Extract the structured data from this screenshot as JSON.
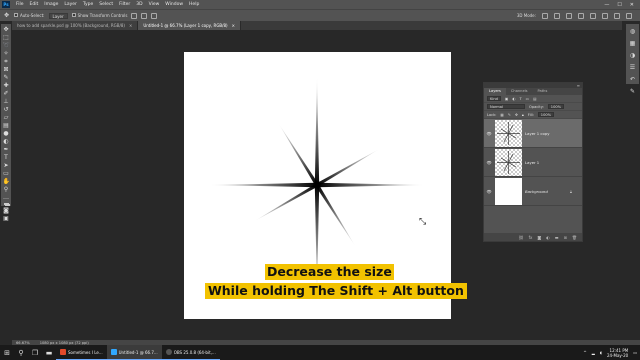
{
  "menubar": {
    "logo": "Ps",
    "items": [
      "File",
      "Edit",
      "Image",
      "Layer",
      "Type",
      "Select",
      "Filter",
      "3D",
      "View",
      "Window",
      "Help"
    ],
    "window_controls": [
      "—",
      "☐",
      "✕"
    ]
  },
  "options": {
    "auto_select_label": "Auto-Select:",
    "auto_select_value": "Layer",
    "transform_controls_label": "Show Transform Controls",
    "mode_label": "3D Mode:"
  },
  "tabs": [
    {
      "label": "how to add sparkle.psd @ 100% (Background, RGB/8)",
      "active": false
    },
    {
      "label": "Untitled-1 @ 66.7% (Layer 1 copy, RGB/8)",
      "active": true
    }
  ],
  "canvas": {
    "caption_1": "Decrease the size",
    "caption_2": "While holding The Shift + Alt button",
    "caption_color": "#f2c200"
  },
  "layers_panel": {
    "tabs": [
      "Layers",
      "Channels",
      "Paths"
    ],
    "kind_label": "Kind",
    "blend_mode": "Normal",
    "opacity_label": "Opacity:",
    "opacity_value": "100%",
    "lock_label": "Lock:",
    "fill_label": "Fill:",
    "fill_value": "100%",
    "layers": [
      {
        "name": "Layer 1 copy",
        "selected": true,
        "type": "sparkle"
      },
      {
        "name": "Layer 1",
        "selected": false,
        "type": "sparkle"
      },
      {
        "name": "Background",
        "selected": false,
        "type": "white",
        "locked": true
      }
    ]
  },
  "status": {
    "zoom": "66.67%",
    "doc_info": "1080 px x 1080 px (72 ppi)"
  },
  "taskbar": {
    "apps": [
      {
        "label": "Sometimes I Le...",
        "color": "#e34a2b",
        "active": false
      },
      {
        "label": "Untitled-1 @ 66.7...",
        "color": "#31a8ff",
        "active": true
      },
      {
        "label": "OBS 25.0.8 (64-bit,...",
        "color": "#555555",
        "active": false
      }
    ],
    "time": "12:41 PM",
    "date": "24-May-20"
  },
  "colors": {
    "foreground": "#0a0a0a",
    "background": "#d41c1c",
    "accent": "#31a8ff"
  }
}
